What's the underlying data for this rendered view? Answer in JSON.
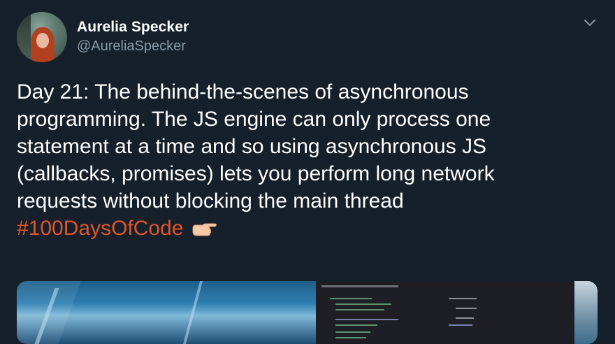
{
  "author": {
    "name": "Aurelia Specker",
    "handle": "@AureliaSpecker"
  },
  "tweet": {
    "lines": [
      "Day 21: The behind-the-scenes of asynchronous",
      "programming. The JS engine can only process one",
      "statement at a time and so using asynchronous JS",
      "(callbacks, promises) lets you perform long network",
      "requests without blocking the main thread"
    ],
    "hashtag": "#100DaysOfCode",
    "emoji": "backhand-index-pointing-right"
  },
  "icons": {
    "more": "chevron-down-icon"
  },
  "colors": {
    "background": "#15202b",
    "text": "#ffffff",
    "secondary": "#8899a6",
    "hashtag": "#e0552a"
  }
}
